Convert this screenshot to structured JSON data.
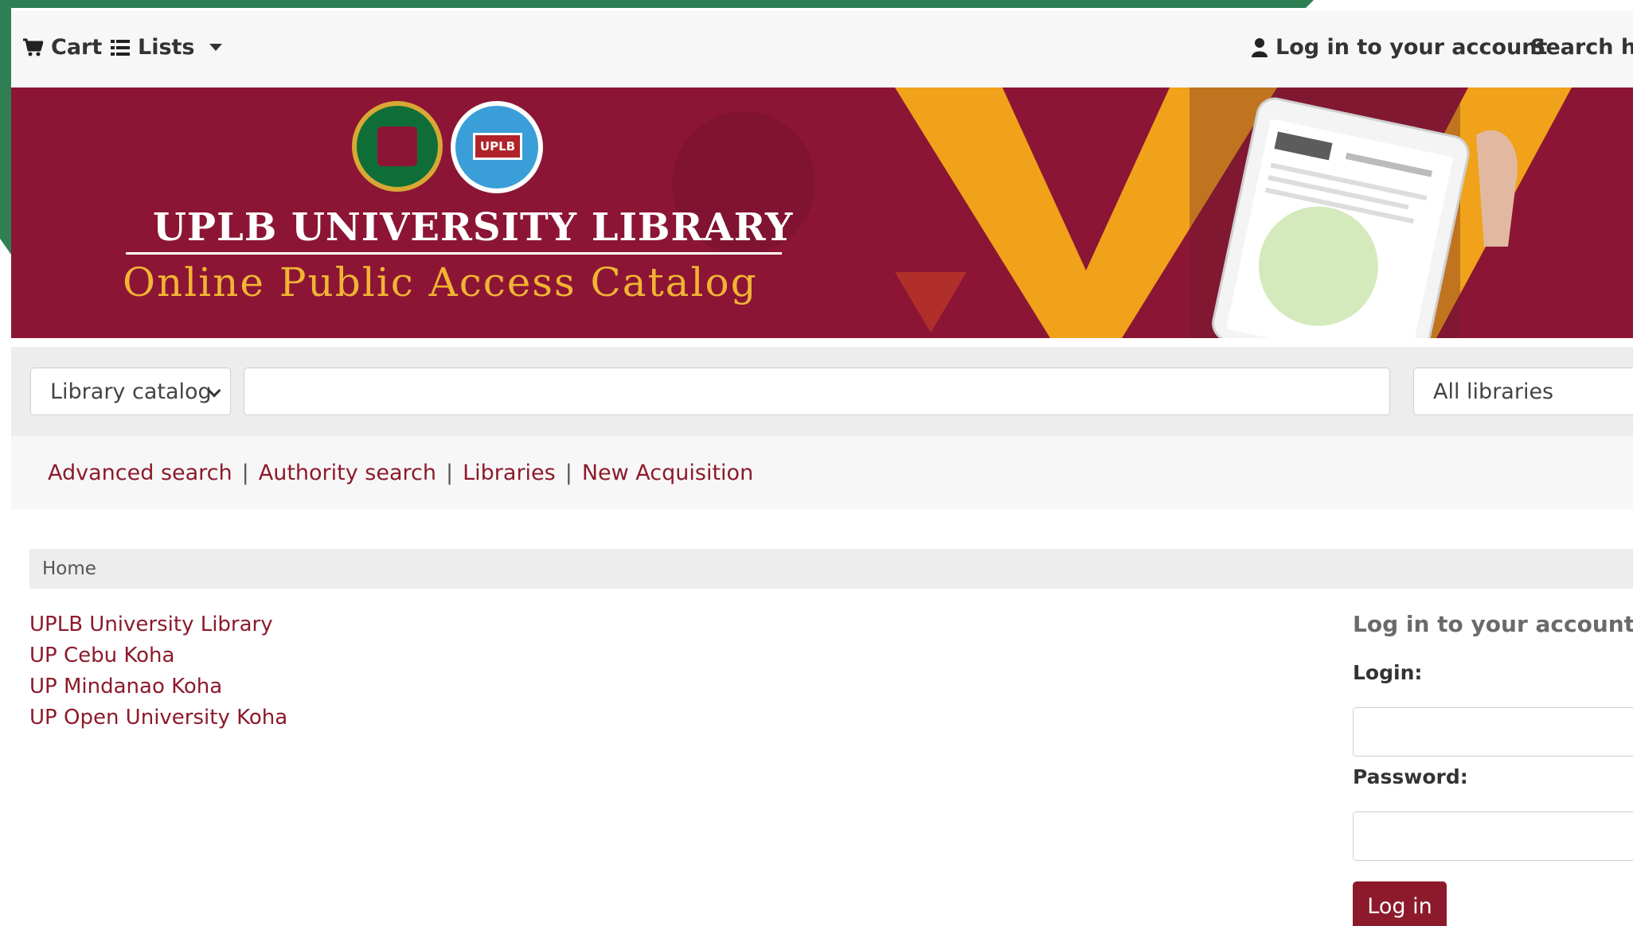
{
  "navbar": {
    "cart_label": "Cart",
    "lists_label": "Lists",
    "login_label": "Log in to your account",
    "search_history_label": "Search his"
  },
  "banner": {
    "title": "UPLB UNIVERSITY LIBRARY",
    "subtitle": "Online Public Access Catalog",
    "seal_text": "UPLB"
  },
  "search": {
    "catalog_select": "Library catalog",
    "query_value": "",
    "library_select": "All libraries"
  },
  "more_searches": [
    "Advanced search",
    "Authority search",
    "Libraries",
    "New Acquisition"
  ],
  "breadcrumb": {
    "home": "Home"
  },
  "links": [
    "UPLB University Library",
    "UP Cebu Koha",
    "UP Mindanao Koha",
    "UP Open University Koha"
  ],
  "login": {
    "heading": "Log in to your account:",
    "login_label": "Login:",
    "password_label": "Password:",
    "button_label": "Log in"
  },
  "colors": {
    "brand_maroon": "#8c1535",
    "link_color": "#8c1a2b",
    "accent_gold": "#f1b433",
    "frame_green": "#2f7f55"
  }
}
